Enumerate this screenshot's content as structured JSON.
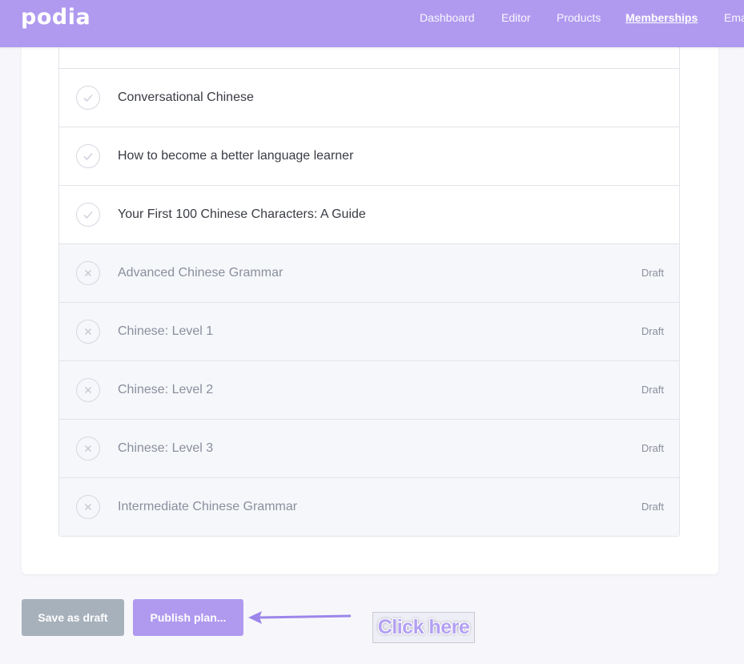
{
  "app": {
    "logo": "podia",
    "brand_color": "#b09af0"
  },
  "nav": [
    {
      "label": "Dashboard",
      "active": false
    },
    {
      "label": "Editor",
      "active": false
    },
    {
      "label": "Products",
      "active": false
    },
    {
      "label": "Memberships",
      "active": true
    },
    {
      "label": "Ema",
      "active": false
    }
  ],
  "products": [
    {
      "title": "",
      "state": "included",
      "icon": "check-icon",
      "status": ""
    },
    {
      "title": "Conversational Chinese",
      "state": "included",
      "icon": "check-icon",
      "status": ""
    },
    {
      "title": "How to become a better language learner",
      "state": "included",
      "icon": "check-icon",
      "status": ""
    },
    {
      "title": "Your First 100 Chinese Characters: A Guide",
      "state": "included",
      "icon": "check-icon",
      "status": ""
    },
    {
      "title": "Advanced Chinese Grammar",
      "state": "draft",
      "icon": "x-icon",
      "status": "Draft"
    },
    {
      "title": "Chinese: Level 1",
      "state": "draft",
      "icon": "x-icon",
      "status": "Draft"
    },
    {
      "title": "Chinese: Level 2",
      "state": "draft",
      "icon": "x-icon",
      "status": "Draft"
    },
    {
      "title": "Chinese: Level 3",
      "state": "draft",
      "icon": "x-icon",
      "status": "Draft"
    },
    {
      "title": "Intermediate Chinese Grammar",
      "state": "draft",
      "icon": "x-icon",
      "status": "Draft"
    }
  ],
  "actions": {
    "save_draft_label": "Save as draft",
    "publish_label": "Publish plan..."
  },
  "annotation": {
    "label": "Click here",
    "color": "#b09af0"
  }
}
